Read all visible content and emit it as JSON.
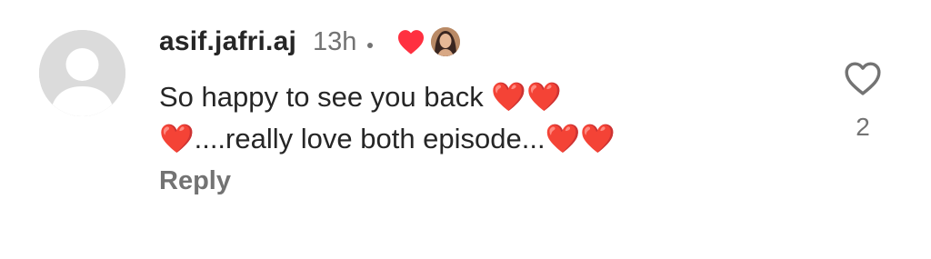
{
  "comment": {
    "username": "asif.jafri.aj",
    "time": "13h",
    "text_line_1": "So happy to see you back ❤️❤️",
    "text_line_2": "❤️....really love both episode...❤️❤️",
    "reply_label": "Reply",
    "like_count": "2",
    "liked_by_author_icon": "red-heart-icon",
    "like_icon": "heart-outline-icon"
  },
  "colors": {
    "username": "#262626",
    "secondary": "#737373",
    "heart": "#ff3040",
    "avatar_placeholder": "#dbdbdb"
  }
}
